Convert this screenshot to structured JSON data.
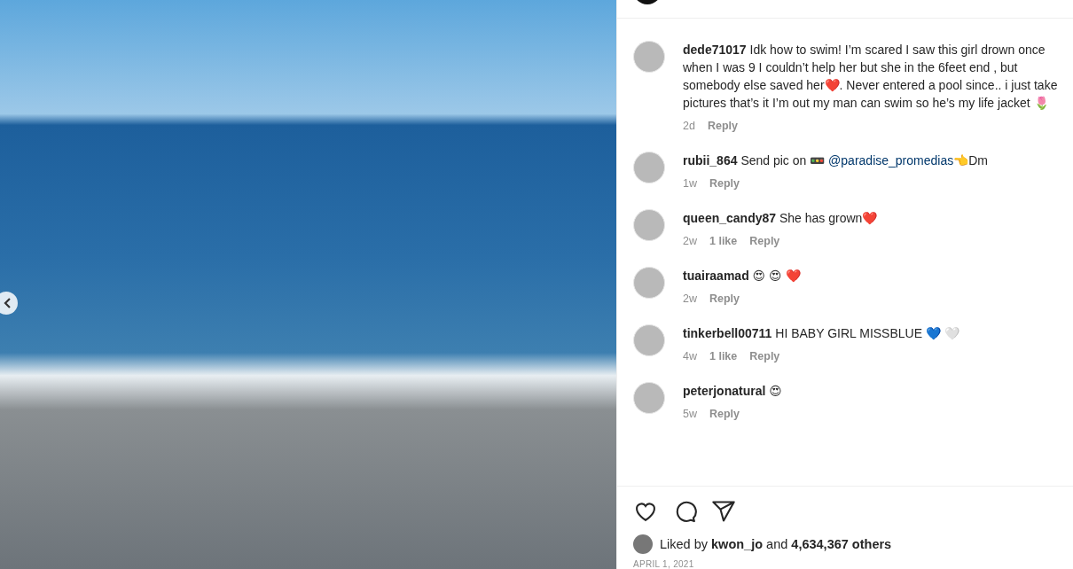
{
  "post": {
    "photo": {
      "carousel_prev": true
    },
    "comments": [
      {
        "user": "dede71017",
        "text": "Idk how to swim! I’m scared I saw this girl drown once when I was 9 I couldn’t help her but she in the 6feet end , but somebody else saved her❤️. Never entered a pool since.. i just take pictures that’s it I’m out my man can swim so he’s my life jacket  🌷",
        "time": "2d",
        "reply": "Reply"
      },
      {
        "user": "rubii_864",
        "text": "Send pic on 🚥",
        "mention": "@paradise_promedias",
        "text_after": "👈Dm",
        "time": "1w",
        "reply": "Reply"
      },
      {
        "user": "queen_candy87",
        "text": "She has grown❤️",
        "time": "2w",
        "likes": "1 like",
        "reply": "Reply"
      },
      {
        "user": "tuairaamad",
        "text": "😍 😍 ❤️",
        "time": "2w",
        "reply": "Reply"
      },
      {
        "user": "tinkerbell00711",
        "text": "HI BABY GIRL MISSBLUE 💙 🤍",
        "time": "4w",
        "likes": "1 like",
        "reply": "Reply"
      },
      {
        "user": "peterjonatural",
        "text": "😍",
        "time": "5w",
        "reply": "Reply"
      }
    ],
    "liked_by": {
      "prefix": "Liked by",
      "user": "kwon_jo",
      "middle": "and",
      "count": "4,634,367 others"
    },
    "date": "APRIL 1, 2021"
  }
}
